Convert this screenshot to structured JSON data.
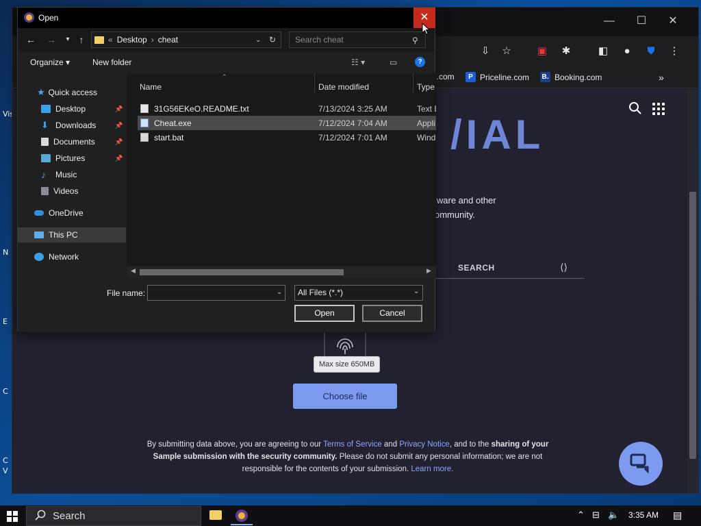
{
  "dialog": {
    "title": "Open",
    "address": {
      "crumbs": [
        "Desktop",
        "cheat"
      ],
      "prefix": "«"
    },
    "search_placeholder": "Search cheat",
    "commands": {
      "organize": "Organize",
      "new_folder": "New folder"
    },
    "nav": {
      "quick_access": "Quick access",
      "items": [
        "Desktop",
        "Downloads",
        "Documents",
        "Pictures",
        "Music",
        "Videos"
      ],
      "onedrive": "OneDrive",
      "this_pc": "This PC",
      "network": "Network"
    },
    "columns": {
      "name": "Name",
      "date": "Date modified",
      "type": "Type"
    },
    "files": [
      {
        "name": "31G56EKeO.README.txt",
        "date": "7/13/2024 3:25 AM",
        "type": "Text D"
      },
      {
        "name": "Cheat.exe",
        "date": "7/12/2024 7:04 AM",
        "type": "Appli"
      },
      {
        "name": "start.bat",
        "date": "7/12/2024 7:01 AM",
        "type": "Wind"
      }
    ],
    "file_name_label": "File name:",
    "file_name_value": "",
    "file_type": "All Files (*.*)",
    "open_label": "Open",
    "cancel_label": "Cancel",
    "close_glyph": "✕"
  },
  "browser": {
    "bookmarks": [
      {
        "label": "e.com"
      },
      {
        "label": "Priceline.com",
        "badge": "P"
      },
      {
        "label": "Booking.com",
        "badge": "B."
      }
    ],
    "page": {
      "logo_fragment": "/IAL",
      "intro_line1": "lware and other",
      "intro_line2": "ommunity.",
      "tab_search": "SEARCH",
      "max_size": "Max size 650MB",
      "choose_file": "Choose file",
      "legal": {
        "p1": "By submitting data above, you are agreeing to our ",
        "tos": "Terms of Service",
        "and": " and ",
        "privacy": "Privacy Notice",
        "p2": ", and to the ",
        "bold1": "sharing of your Sample submission with the security community.",
        "p3": " Please do not submit any personal information; we are not responsible for the contents of your submission. ",
        "learn": "Learn more."
      }
    }
  },
  "desktop": {
    "side_letters": [
      "Vis",
      "N",
      "E",
      "C",
      "C",
      "V"
    ]
  },
  "taskbar": {
    "search_label": "Search",
    "time": "3:35 AM"
  },
  "colors": {
    "accent": "#7c9bf0",
    "close_red": "#c42b1c",
    "link": "#8fa6ff"
  }
}
